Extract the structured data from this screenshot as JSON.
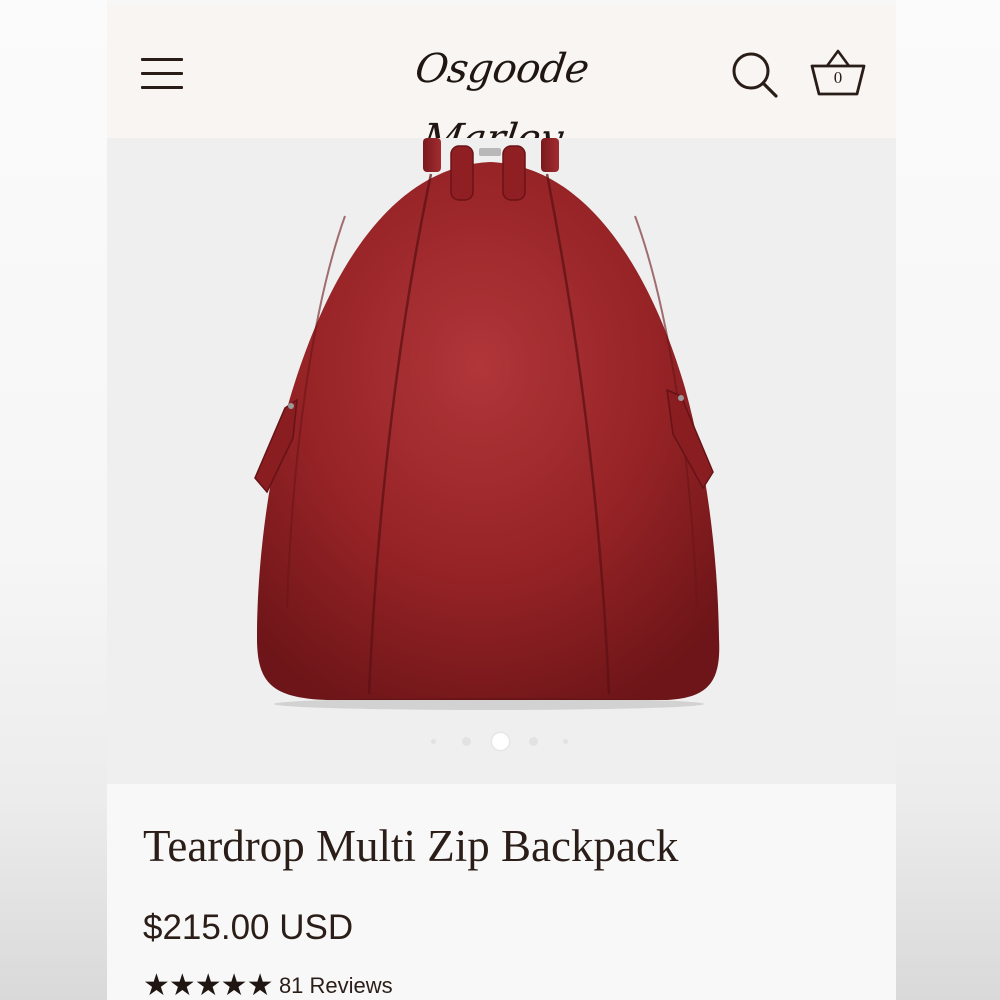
{
  "header": {
    "brand": "Osgoode Marley",
    "cart_count": "0",
    "icons": {
      "menu": "hamburger-menu-icon",
      "search": "search-icon",
      "cart": "basket-icon"
    }
  },
  "product": {
    "title": "Teardrop Multi Zip Backpack",
    "price": "$215.00 USD",
    "rating": 5,
    "rating_stars": "★★★★★",
    "reviews_label": "81 Reviews",
    "image_color": "#8f1f22"
  },
  "gallery": {
    "image_count": 5,
    "active_index": 2
  },
  "colors": {
    "brand_dark": "#2b1e18",
    "header_bg": "#f8f5f2",
    "image_bg": "#efefef"
  }
}
